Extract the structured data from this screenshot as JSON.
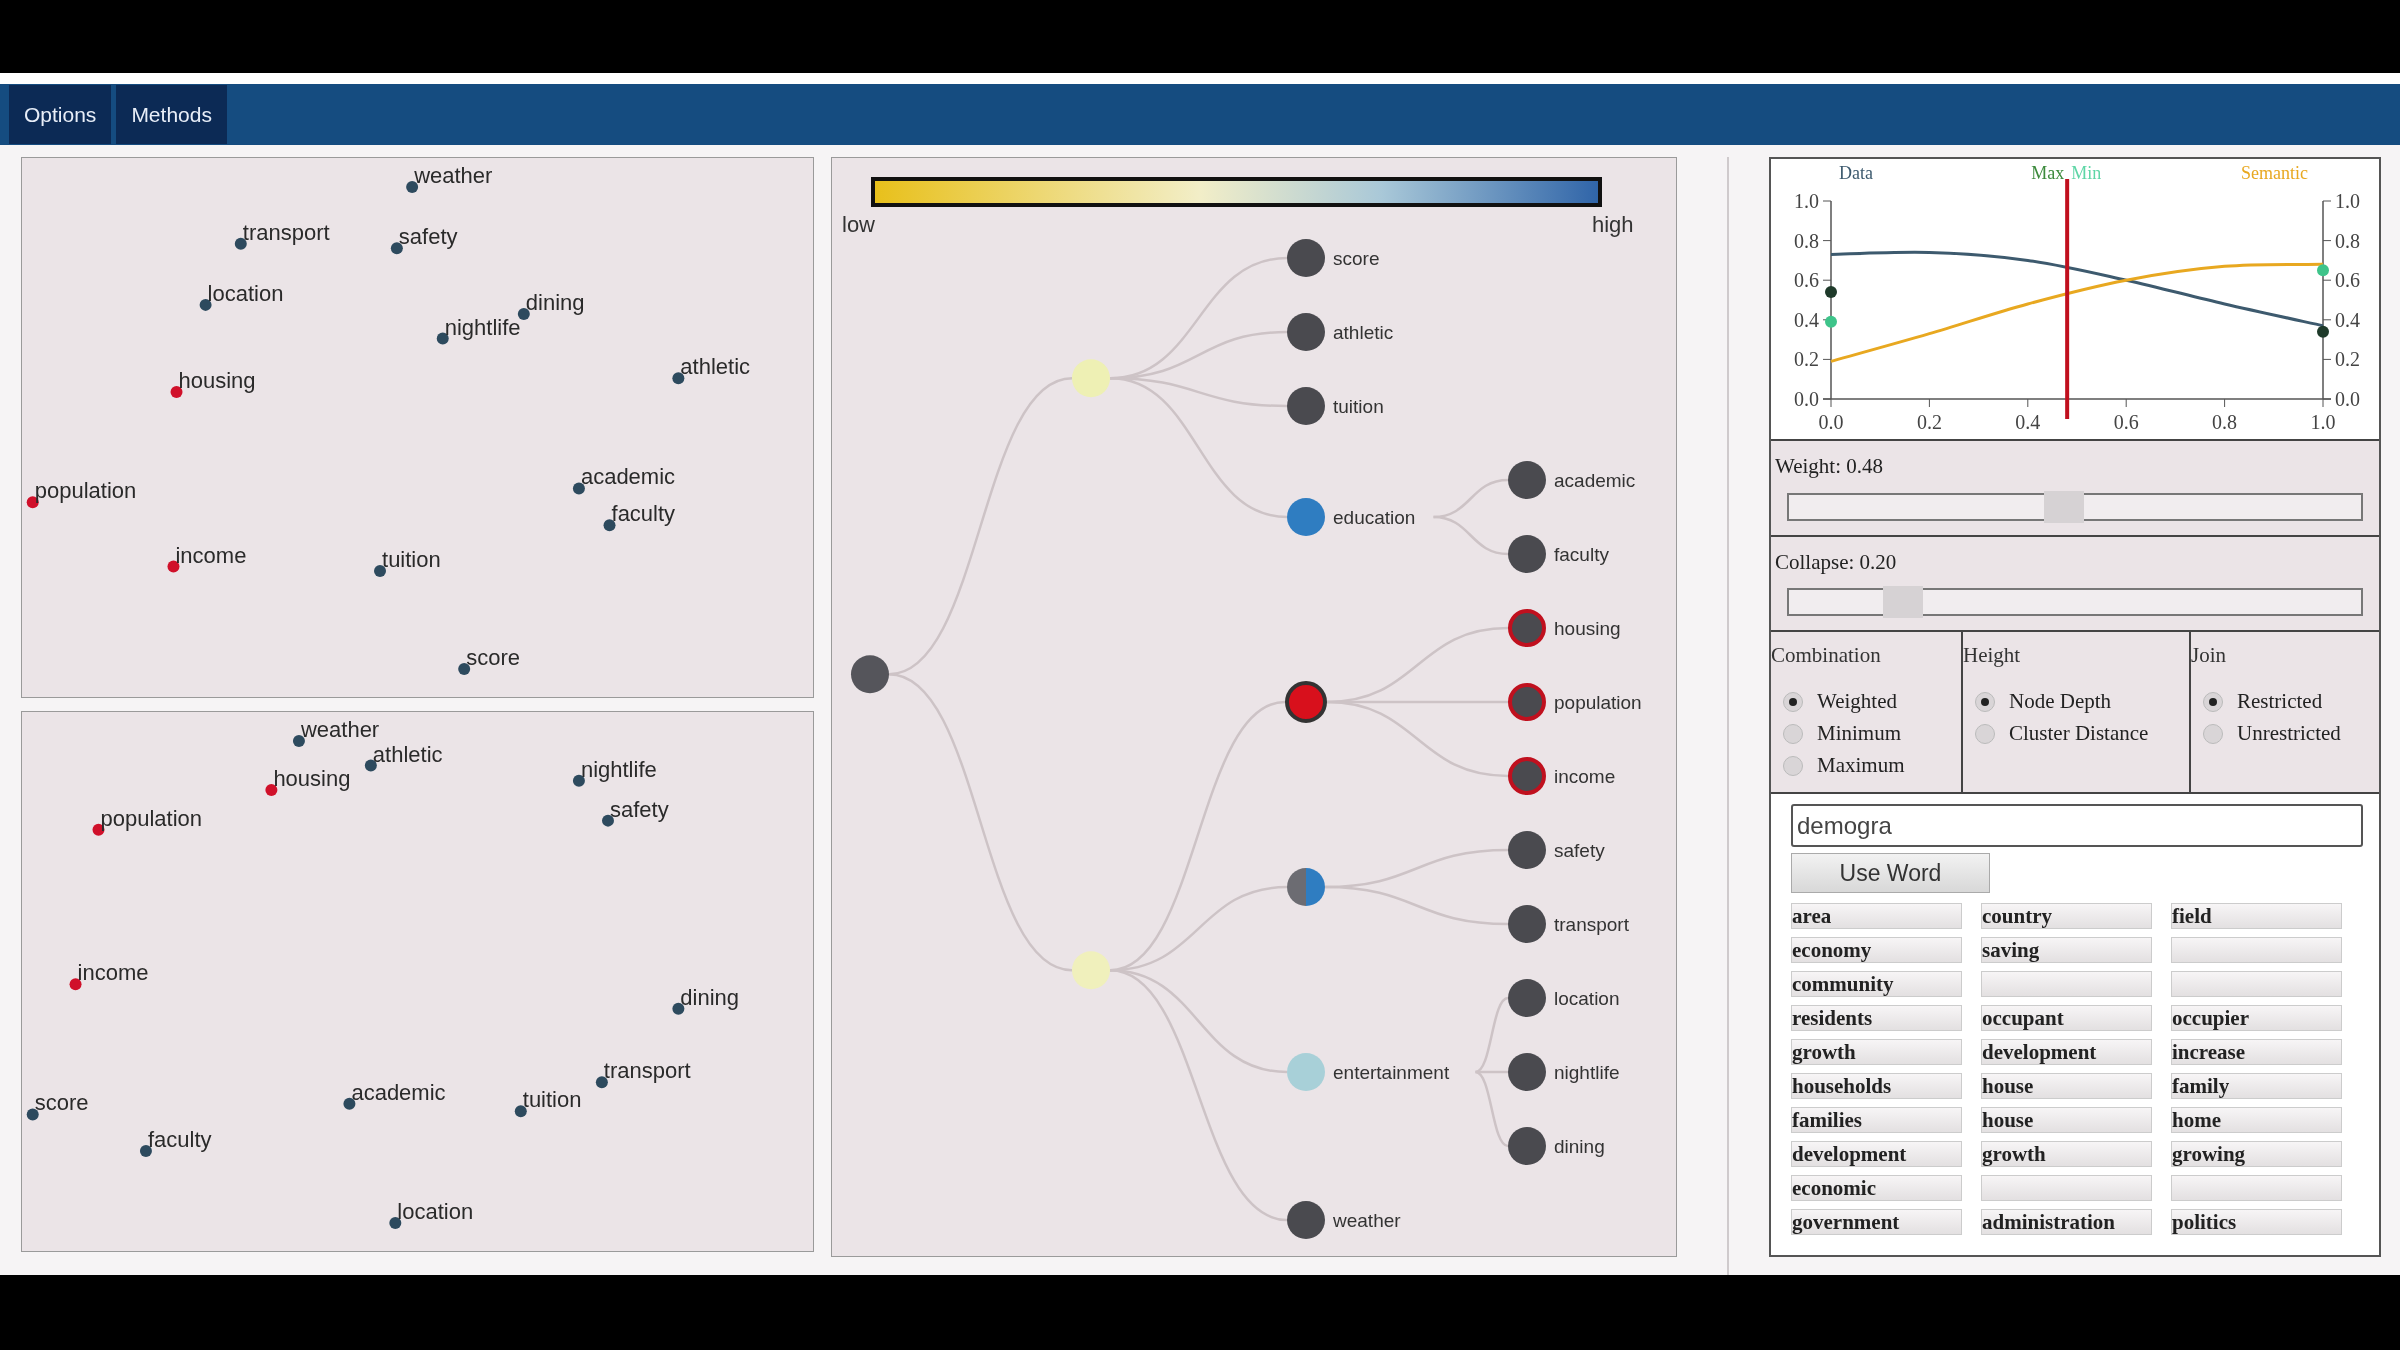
{
  "nav": {
    "tabs": [
      {
        "label": "Options"
      },
      {
        "label": "Methods"
      }
    ]
  },
  "embeddings": [
    {
      "points": [
        {
          "label": "weather",
          "color": "#2d4a5e"
        },
        {
          "label": "transport",
          "color": "#2d4a5e"
        },
        {
          "label": "safety",
          "color": "#2d4a5e"
        },
        {
          "label": "location",
          "color": "#2d4a5e"
        },
        {
          "label": "dining",
          "color": "#2d4a5e"
        },
        {
          "label": "nightlife",
          "color": "#2d4a5e"
        },
        {
          "label": "housing",
          "color": "#d0102a"
        },
        {
          "label": "athletic",
          "color": "#2d4a5e"
        },
        {
          "label": "population",
          "color": "#d0102a"
        },
        {
          "label": "academic",
          "color": "#2d4a5e"
        },
        {
          "label": "faculty",
          "color": "#2d4a5e"
        },
        {
          "label": "income",
          "color": "#d0102a"
        },
        {
          "label": "tuition",
          "color": "#2d4a5e"
        },
        {
          "label": "score",
          "color": "#2d4a5e"
        }
      ]
    },
    {
      "points": [
        {
          "label": "weather",
          "color": "#2d4a5e"
        },
        {
          "label": "athletic",
          "color": "#2d4a5e"
        },
        {
          "label": "housing",
          "color": "#d0102a"
        },
        {
          "label": "nightlife",
          "color": "#2d4a5e"
        },
        {
          "label": "population",
          "color": "#d0102a"
        },
        {
          "label": "safety",
          "color": "#2d4a5e"
        },
        {
          "label": "income",
          "color": "#d0102a"
        },
        {
          "label": "dining",
          "color": "#2d4a5e"
        },
        {
          "label": "transport",
          "color": "#2d4a5e"
        },
        {
          "label": "score",
          "color": "#2d4a5e"
        },
        {
          "label": "academic",
          "color": "#2d4a5e"
        },
        {
          "label": "tuition",
          "color": "#2d4a5e"
        },
        {
          "label": "faculty",
          "color": "#2d4a5e"
        },
        {
          "label": "location",
          "color": "#2d4a5e"
        }
      ]
    }
  ],
  "colorbar": {
    "low": "low",
    "high": "high"
  },
  "tree": {
    "color": "#55555b",
    "children": [
      {
        "color": "#eef0b4",
        "children": [
          {
            "label": "score",
            "color": "#4a4a4f"
          },
          {
            "label": "athletic",
            "color": "#4a4a4f"
          },
          {
            "label": "tuition",
            "color": "#4a4a4f"
          },
          {
            "label": "education",
            "color": "#2f7dc1",
            "children": [
              {
                "label": "academic",
                "color": "#4a4a4f"
              },
              {
                "label": "faculty",
                "color": "#4a4a4f"
              }
            ]
          }
        ]
      },
      {
        "color": "#f0f0bc",
        "children": [
          {
            "kind": "full",
            "color": "#d8101c",
            "highlighted": true,
            "children": [
              {
                "label": "housing",
                "color": "#4a4a4f",
                "highlighted": true
              },
              {
                "label": "population",
                "color": "#4a4a4f",
                "highlighted": true
              },
              {
                "label": "income",
                "color": "#4a4a4f",
                "highlighted": true
              }
            ]
          },
          {
            "kind": "half",
            "color": "#2f7dc1",
            "children": [
              {
                "label": "safety",
                "color": "#4a4a4f"
              },
              {
                "label": "transport",
                "color": "#4a4a4f"
              }
            ]
          },
          {
            "kind": "full",
            "label": "entertainment",
            "color": "#a8d0d8",
            "children": [
              {
                "label": "location",
                "color": "#4a4a4f"
              },
              {
                "label": "nightlife",
                "color": "#4a4a4f"
              },
              {
                "label": "dining",
                "color": "#4a4a4f"
              }
            ]
          },
          {
            "kind": "full",
            "label": "weather",
            "color": "#4a4a4f"
          }
        ]
      }
    ]
  },
  "chart_data": {
    "type": "line",
    "x": [
      0,
      0.2,
      0.4,
      0.6,
      0.8,
      1.0
    ],
    "series": [
      {
        "name": "Data",
        "color": "#3d5a6e",
        "values": [
          0.73,
          0.74,
          0.7,
          0.6,
          0.48,
          0.37
        ]
      },
      {
        "name": "Semantic",
        "color": "#e8a820",
        "values": [
          0.19,
          0.33,
          0.48,
          0.6,
          0.67,
          0.68
        ]
      }
    ],
    "xlim": [
      0,
      1
    ],
    "ylim": [
      0,
      1
    ],
    "xticks": [
      {
        "value": 0,
        "label": "0.0"
      },
      {
        "value": 0.2,
        "label": "0.2"
      },
      {
        "value": 0.4,
        "label": "0.4"
      },
      {
        "value": 0.6,
        "label": "0.6"
      },
      {
        "value": 0.8,
        "label": "0.8"
      },
      {
        "value": 1,
        "label": "1.0"
      }
    ],
    "yticks": [
      {
        "value": 0,
        "label": "0.0"
      },
      {
        "value": 0.2,
        "label": "0.2"
      },
      {
        "value": 0.4,
        "label": "0.4"
      },
      {
        "value": 0.6,
        "label": "0.6"
      },
      {
        "value": 0.8,
        "label": "0.8"
      },
      {
        "value": 1,
        "label": "1.0"
      }
    ],
    "ref_lines": [
      {
        "axis": "x",
        "value": 0.48,
        "color": "#c0101e"
      }
    ]
  },
  "threshold_labels": [
    {
      "text": "Max",
      "color": "#3c8a3c"
    },
    {
      "text": "Min",
      "color": "#5ed6a6"
    }
  ],
  "sliders": [
    {
      "label": "Weight: 0.48",
      "level": 0.48
    },
    {
      "label": "Collapse: 0.20",
      "level": 0.2
    }
  ],
  "radio_groups": [
    {
      "title": "Combination",
      "options": [
        {
          "label": "Weighted",
          "selected": true
        },
        {
          "label": "Minimum",
          "selected": false
        },
        {
          "label": "Maximum",
          "selected": false
        }
      ]
    },
    {
      "title": "Height",
      "options": [
        {
          "label": "Node Depth",
          "selected": true
        },
        {
          "label": "Cluster Distance",
          "selected": false
        }
      ]
    },
    {
      "title": "Join",
      "options": [
        {
          "label": "Restricted",
          "selected": true
        },
        {
          "label": "Unrestricted",
          "selected": false
        }
      ]
    }
  ],
  "word_input": {
    "value": "demogra"
  },
  "use_word_button": "Use Word",
  "suggestions": [
    {
      "column_1": "area",
      "column_2": "country",
      "column_3": "field"
    },
    {
      "column_1": "economy",
      "column_2": "saving"
    },
    {
      "column_1": "community"
    },
    {
      "column_1": "residents",
      "column_2": "occupant",
      "column_3": "occupier"
    },
    {
      "column_1": "growth",
      "column_2": "development",
      "column_3": "increase"
    },
    {
      "column_1": "households",
      "column_2": "house",
      "column_3": "family"
    },
    {
      "column_1": "families",
      "column_2": "house",
      "column_3": "home"
    },
    {
      "column_1": "development",
      "column_2": "growth",
      "column_3": "growing"
    },
    {
      "column_1": "economic"
    },
    {
      "column_1": "government",
      "column_2": "administration",
      "column_3": "politics"
    }
  ]
}
